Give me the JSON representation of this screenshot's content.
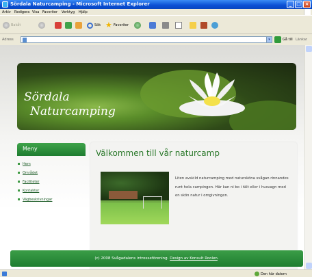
{
  "window": {
    "title": "Sördala Naturcamping - Microsoft Internet Explorer",
    "minimize": "_",
    "maximize": "□",
    "close": "×"
  },
  "menubar": {
    "items": [
      "Arkiv",
      "Redigera",
      "Visa",
      "Favoriter",
      "Verktyg",
      "Hjälp"
    ]
  },
  "toolbar": {
    "back_label": "Bakåt",
    "search_label": "Sök",
    "favorites_label": "Favoriter"
  },
  "addressbar": {
    "label": "Adress",
    "value": "",
    "go_label": "Gå till",
    "links_label": "Länkar"
  },
  "banner": {
    "title_line1": "Sördala",
    "title_line2": "Naturcamping"
  },
  "menu": {
    "heading": "Meny",
    "items": [
      "Hem",
      "Området",
      "Faciliteter",
      "Kontakter",
      "Vägbeskrivningar"
    ]
  },
  "content": {
    "heading": "Välkommen till vår naturcamp",
    "text": "Liten avskild naturcamping med natursköna svågan rinnandes runt hela campingen. Här kan ni bo i tält eller i husvagn med en skön natur i omgivningen."
  },
  "footer": {
    "copyright": "(c) 2008 Svågadalens intresseförening.",
    "design_link": "Design av Konsult Roolen"
  },
  "statusbar": {
    "zone": "Den här datorn"
  },
  "colors": {
    "accent_green": "#2d7a2d",
    "footer_green": "#1e7d30",
    "xp_blue": "#0a4fd4"
  },
  "icons": {
    "titlebar": "ie-icon",
    "lily": "water-lily-image",
    "photo": "campsite-photo"
  }
}
